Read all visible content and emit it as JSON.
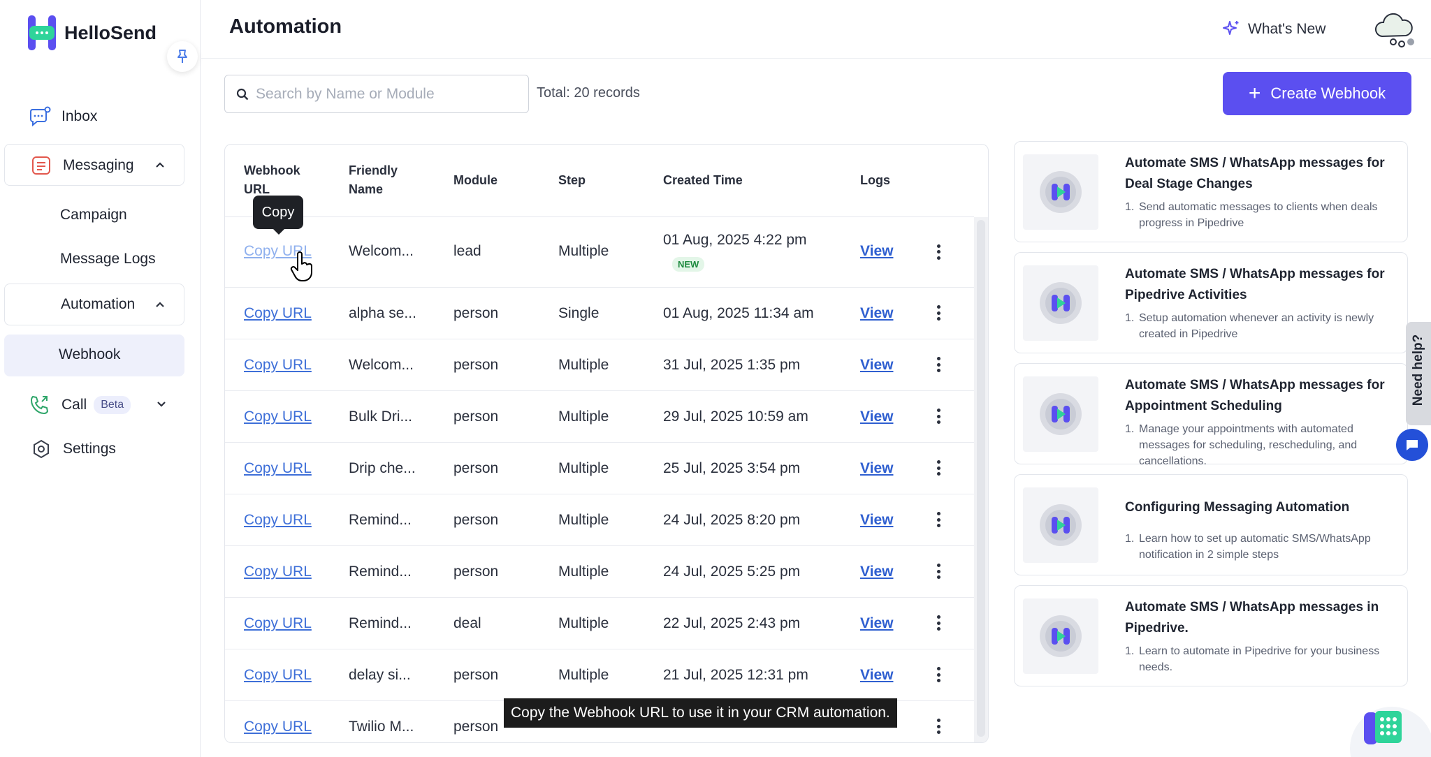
{
  "app": {
    "name": "HelloSend"
  },
  "sidebar": {
    "items": [
      {
        "label": "Inbox",
        "icon": "chat-bubble-icon"
      },
      {
        "label": "Messaging",
        "icon": "message-icon"
      },
      {
        "label": "Campaign"
      },
      {
        "label": "Message Logs"
      },
      {
        "label": "Automation"
      },
      {
        "label": "Webhook"
      },
      {
        "label": "Call",
        "badge": "Beta",
        "icon": "phone-icon"
      },
      {
        "label": "Settings",
        "icon": "gear-icon"
      }
    ]
  },
  "header": {
    "title": "Automation",
    "whats_new": "What's New"
  },
  "toolbar": {
    "search_placeholder": "Search by Name or Module",
    "total": "Total: 20 records",
    "create_label": "Create Webhook"
  },
  "table": {
    "headers": [
      "Webhook URL",
      "Friendly Name",
      "Module",
      "Step",
      "Created Time",
      "Logs"
    ],
    "header_lines": {
      "webhook": [
        "Webhook",
        "URL"
      ],
      "friendly": [
        "Friendly",
        "Name"
      ]
    },
    "rows": [
      {
        "url": "Copy URL",
        "name": "Welcom...",
        "module": "lead",
        "step": "Multiple",
        "created": "01 Aug, 2025 4:22 pm",
        "badge": "NEW",
        "logs": "View"
      },
      {
        "url": "Copy URL",
        "name": "alpha se...",
        "module": "person",
        "step": "Single",
        "created": "01 Aug, 2025 11:34 am",
        "logs": "View"
      },
      {
        "url": "Copy URL",
        "name": "Welcom...",
        "module": "person",
        "step": "Multiple",
        "created": "31 Jul, 2025 1:35 pm",
        "logs": "View"
      },
      {
        "url": "Copy URL",
        "name": "Bulk Dri...",
        "module": "person",
        "step": "Multiple",
        "created": "29 Jul, 2025 10:59 am",
        "logs": "View"
      },
      {
        "url": "Copy URL",
        "name": "Drip che...",
        "module": "person",
        "step": "Multiple",
        "created": "25 Jul, 2025 3:54 pm",
        "logs": "View"
      },
      {
        "url": "Copy URL",
        "name": "Remind...",
        "module": "person",
        "step": "Multiple",
        "created": "24 Jul, 2025 8:20 pm",
        "logs": "View"
      },
      {
        "url": "Copy URL",
        "name": "Remind...",
        "module": "person",
        "step": "Multiple",
        "created": "24 Jul, 2025 5:25 pm",
        "logs": "View"
      },
      {
        "url": "Copy URL",
        "name": "Remind...",
        "module": "deal",
        "step": "Multiple",
        "created": "22 Jul, 2025 2:43 pm",
        "logs": "View"
      },
      {
        "url": "Copy URL",
        "name": "delay si...",
        "module": "person",
        "step": "Multiple",
        "created": "21 Jul, 2025 12:31 pm",
        "logs": "View"
      },
      {
        "url": "Copy URL",
        "name": "Twilio M...",
        "module": "person",
        "step": "",
        "created": "",
        "logs": ""
      }
    ]
  },
  "tooltip": "Copy",
  "cards": [
    {
      "title": "Automate SMS / WhatsApp messages for Deal Stage Changes",
      "num": "1.",
      "desc": "Send automatic messages to clients when deals progress in Pipedrive"
    },
    {
      "title": "Automate SMS / WhatsApp messages for Pipedrive Activities",
      "num": "1.",
      "desc": "Setup automation whenever an activity is newly created in Pipedrive"
    },
    {
      "title": "Automate SMS / WhatsApp messages for Appointment Scheduling",
      "num": "1.",
      "desc": "Manage your appointments with automated messages for scheduling, rescheduling, and cancellations."
    },
    {
      "title": "Configuring Messaging Automation",
      "num": "1.",
      "desc": "Learn how to set up automatic SMS/WhatsApp notification in 2 simple steps"
    },
    {
      "title": "Automate SMS / WhatsApp messages in Pipedrive.",
      "num": "1.",
      "desc": "Learn to automate in Pipedrive for your business needs."
    }
  ],
  "help": {
    "label": "Need help?"
  },
  "caption": "Copy the Webhook URL to use it in your CRM automation.",
  "colors": {
    "accent": "#5b4ff0",
    "link": "#3e6fd8",
    "new_badge": "#1d8a3e"
  }
}
